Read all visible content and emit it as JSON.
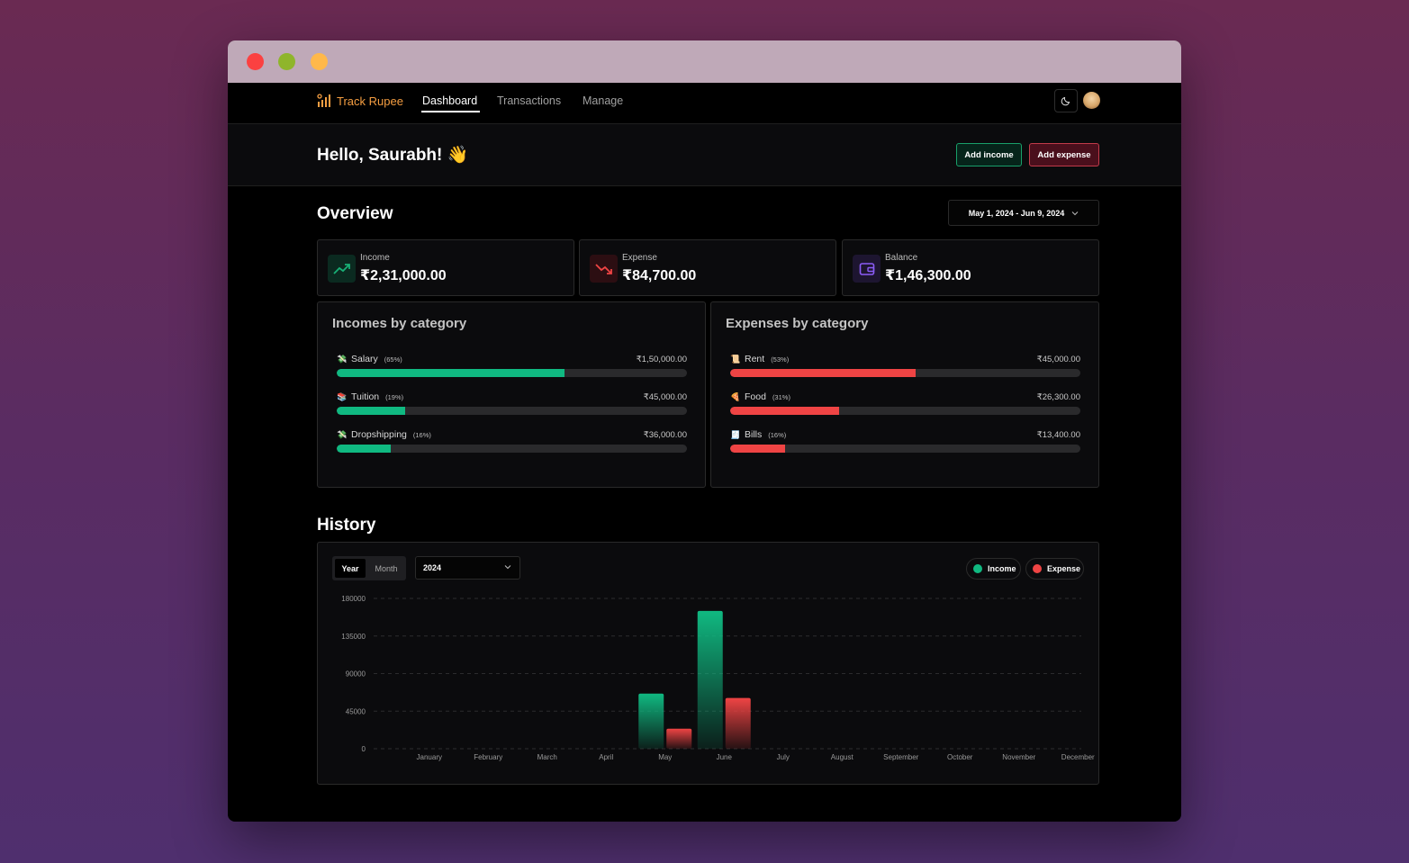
{
  "app": {
    "brand": "Track Rupee",
    "nav": [
      "Dashboard",
      "Transactions",
      "Manage"
    ],
    "active_nav": "Dashboard"
  },
  "greeting": "Hello, Saurabh! 👋",
  "actions": {
    "add_income": "Add income",
    "add_expense": "Add expense"
  },
  "overview": {
    "title": "Overview",
    "date_range": "May 1, 2024 - Jun 9, 2024",
    "stats": [
      {
        "label": "Income",
        "value": "₹2,31,000.00",
        "icon": "trending-up-icon",
        "color": "#18b076"
      },
      {
        "label": "Expense",
        "value": "₹84,700.00",
        "icon": "trending-down-icon",
        "color": "#ef4444"
      },
      {
        "label": "Balance",
        "value": "₹1,46,300.00",
        "icon": "wallet-icon",
        "color": "#8b5cf6"
      }
    ]
  },
  "incomes_by_category": {
    "title": "Incomes by category",
    "items": [
      {
        "emoji": "💸",
        "name": "Salary",
        "pct": "(65%)",
        "amount": "₹1,50,000.00",
        "fraction": 0.65
      },
      {
        "emoji": "📚",
        "name": "Tuition",
        "pct": "(19%)",
        "amount": "₹45,000.00",
        "fraction": 0.195
      },
      {
        "emoji": "💸",
        "name": "Dropshipping",
        "pct": "(16%)",
        "amount": "₹36,000.00",
        "fraction": 0.155
      }
    ],
    "color": "#10b981"
  },
  "expenses_by_category": {
    "title": "Expenses by category",
    "items": [
      {
        "emoji": "📜",
        "name": "Rent",
        "pct": "(53%)",
        "amount": "₹45,000.00",
        "fraction": 0.53
      },
      {
        "emoji": "🍕",
        "name": "Food",
        "pct": "(31%)",
        "amount": "₹26,300.00",
        "fraction": 0.31
      },
      {
        "emoji": "🧾",
        "name": "Bills",
        "pct": "(16%)",
        "amount": "₹13,400.00",
        "fraction": 0.158
      }
    ],
    "color": "#ef4444"
  },
  "history": {
    "title": "History",
    "toggle": [
      "Year",
      "Month"
    ],
    "selected_year": "2024",
    "legend": [
      "Income",
      "Expense"
    ]
  },
  "chart_data": {
    "type": "bar",
    "categories": [
      "January",
      "February",
      "March",
      "April",
      "May",
      "June",
      "July",
      "August",
      "September",
      "October",
      "November",
      "December"
    ],
    "series": [
      {
        "name": "Income",
        "color": "#10b981",
        "values": [
          0,
          0,
          0,
          0,
          66000,
          165000,
          0,
          0,
          0,
          0,
          0,
          0
        ]
      },
      {
        "name": "Expense",
        "color": "#ef4444",
        "values": [
          0,
          0,
          0,
          0,
          24000,
          60700,
          0,
          0,
          0,
          0,
          0,
          0
        ]
      }
    ],
    "yticks": [
      "180000",
      "135000",
      "90000",
      "45000",
      "0"
    ],
    "ylim": [
      0,
      180000
    ],
    "grid": true,
    "legend": "top-right"
  }
}
